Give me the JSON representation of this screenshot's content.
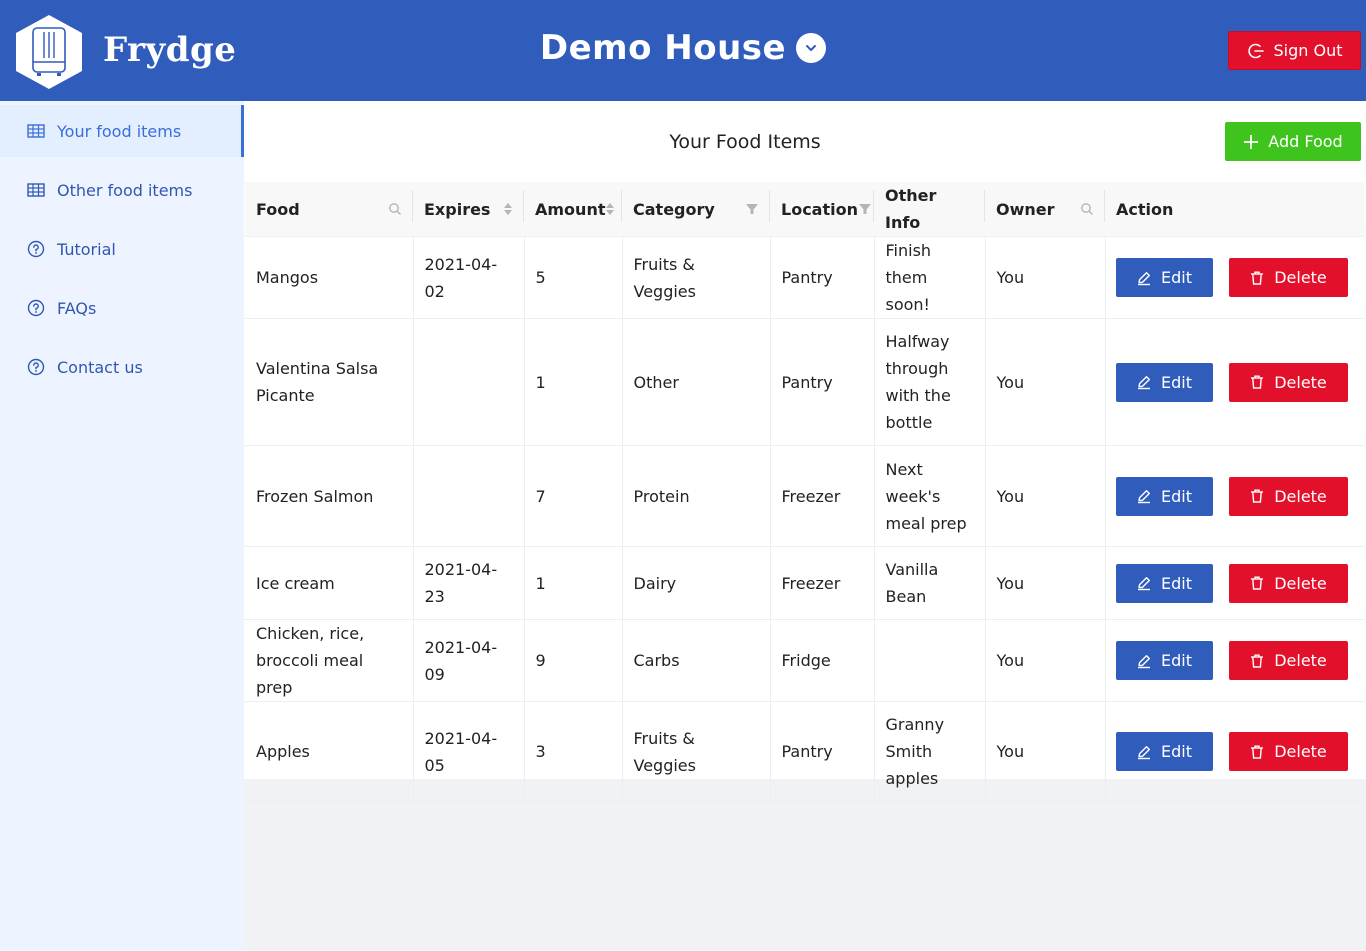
{
  "header": {
    "brand": "Frydge",
    "house": "Demo House",
    "sign_out": "Sign Out",
    "colors": {
      "header_bg": "#305cbc",
      "danger": "#e3102b",
      "success": "#3fc41d"
    }
  },
  "sidebar": {
    "items": [
      {
        "label": "Your food items",
        "icon": "table-icon",
        "active": true
      },
      {
        "label": "Other food items",
        "icon": "table-icon",
        "active": false
      },
      {
        "label": "Tutorial",
        "icon": "question-circle-icon",
        "active": false
      },
      {
        "label": "FAQs",
        "icon": "question-circle-icon",
        "active": false
      },
      {
        "label": "Contact us",
        "icon": "question-circle-icon",
        "active": false
      }
    ]
  },
  "main": {
    "title": "Your Food Items",
    "add_food": "Add Food",
    "columns": [
      {
        "label": "Food",
        "control": "search-icon"
      },
      {
        "label": "Expires",
        "control": "sort-icon"
      },
      {
        "label": "Amount",
        "control": "sort-icon"
      },
      {
        "label": "Category",
        "control": "filter-icon"
      },
      {
        "label": "Location",
        "control": "filter-icon"
      },
      {
        "label": "Other Info",
        "control": ""
      },
      {
        "label": "Owner",
        "control": "search-icon"
      },
      {
        "label": "Action",
        "control": ""
      }
    ],
    "edit_label": "Edit",
    "delete_label": "Delete",
    "rows": [
      {
        "food": "Mangos",
        "expires": "2021-04-02",
        "amount": "5",
        "category": "Fruits & Veggies",
        "location": "Pantry",
        "other": "Finish them soon!",
        "owner": "You"
      },
      {
        "food": "Valentina Salsa Picante",
        "expires": "",
        "amount": "1",
        "category": "Other",
        "location": "Pantry",
        "other": "Halfway through with the bottle",
        "owner": "You"
      },
      {
        "food": "Frozen Salmon",
        "expires": "",
        "amount": "7",
        "category": "Protein",
        "location": "Freezer",
        "other": "Next week's meal prep",
        "owner": "You"
      },
      {
        "food": "Ice cream",
        "expires": "2021-04-23",
        "amount": "1",
        "category": "Dairy",
        "location": "Freezer",
        "other": "Vanilla Bean",
        "owner": "You"
      },
      {
        "food": "Chicken, rice, broccoli meal prep",
        "expires": "2021-04-09",
        "amount": "9",
        "category": "Carbs",
        "location": "Fridge",
        "other": "",
        "owner": "You"
      },
      {
        "food": "Apples",
        "expires": "2021-04-05",
        "amount": "3",
        "category": "Fruits & Veggies",
        "location": "Pantry",
        "other": "Granny Smith apples",
        "owner": "You"
      }
    ]
  }
}
